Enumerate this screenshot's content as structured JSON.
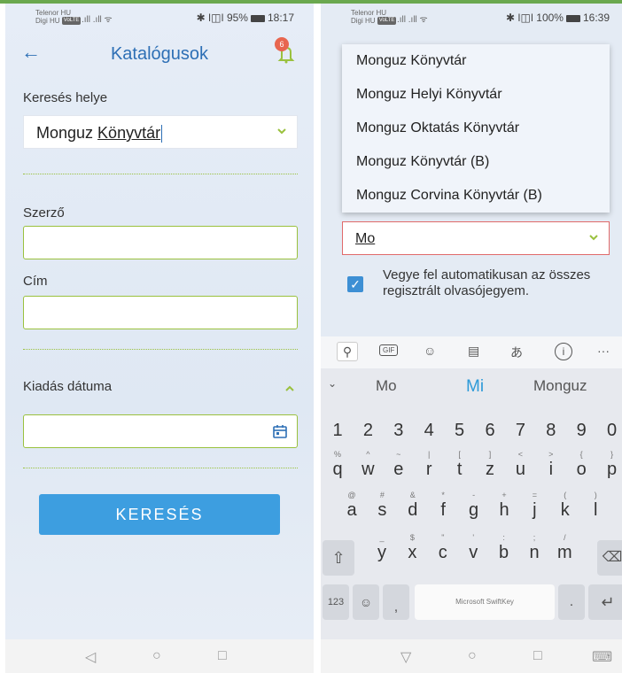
{
  "left": {
    "status": {
      "carrier1": "Telenor HU",
      "carrier2": "Digi HU",
      "volte": "VoLTE",
      "signal": ".ıll .ıll ᯤ",
      "right": "✱ ǀ◫ǀ 95%",
      "time": "18:17"
    },
    "header": {
      "back": "←",
      "title": "Katalógusok",
      "badge": "6"
    },
    "search_place_label": "Keresés helye",
    "search_place_value_a": "Monguz ",
    "search_place_value_b": "Könyvtár",
    "author_label": "Szerző",
    "title_label": "Cím",
    "date_section": "Kiadás dátuma",
    "search_button": "KERESÉS",
    "nav": {
      "back": "◁",
      "home": "○",
      "recent": "□"
    }
  },
  "right": {
    "status": {
      "carrier1": "Telenor HU",
      "carrier2": "Digi HU",
      "volte": "VoLTE",
      "signal": ".ıll .ıll ᯤ",
      "right": "✱ ǀ◫ǀ 100%",
      "time": "16:39"
    },
    "dropdown": [
      "Monguz Könyvtár",
      "Monguz Helyi Könyvtár",
      "Monguz Oktatás Könyvtár",
      "Monguz Könyvtár (B)",
      "Monguz Corvina Könyvtár (B)"
    ],
    "input_value": "Mo",
    "checkbox_text": "Vegye fel automatikusan az összes regisztrált olvasójegyem.",
    "toolbar": {
      "gif": "GIF",
      "more": "···"
    },
    "suggestions": [
      "Mo",
      "Mi",
      "Monguz"
    ],
    "numbers": [
      "1",
      "2",
      "3",
      "4",
      "5",
      "6",
      "7",
      "8",
      "9",
      "0"
    ],
    "row_q": [
      {
        "k": "q",
        "s": "%"
      },
      {
        "k": "w",
        "s": "^"
      },
      {
        "k": "e",
        "s": "~"
      },
      {
        "k": "r",
        "s": "|"
      },
      {
        "k": "t",
        "s": "["
      },
      {
        "k": "z",
        "s": "]"
      },
      {
        "k": "u",
        "s": "<"
      },
      {
        "k": "i",
        "s": ">"
      },
      {
        "k": "o",
        "s": "{"
      },
      {
        "k": "p",
        "s": "}"
      }
    ],
    "row_a": [
      {
        "k": "a",
        "s": "@"
      },
      {
        "k": "s",
        "s": "#"
      },
      {
        "k": "d",
        "s": "&"
      },
      {
        "k": "f",
        "s": "*"
      },
      {
        "k": "g",
        "s": "-"
      },
      {
        "k": "h",
        "s": "+"
      },
      {
        "k": "j",
        "s": "="
      },
      {
        "k": "k",
        "s": "("
      },
      {
        "k": "l",
        "s": ")"
      }
    ],
    "row_y": [
      {
        "k": "y",
        "s": "_"
      },
      {
        "k": "x",
        "s": "$"
      },
      {
        "k": "c",
        "s": "\""
      },
      {
        "k": "v",
        "s": "'"
      },
      {
        "k": "b",
        "s": ":"
      },
      {
        "k": "n",
        "s": ";"
      },
      {
        "k": "m",
        "s": "/"
      }
    ],
    "key_123": "123",
    "space_label": "Microsoft SwiftKey",
    "comma": ",",
    "period": ".",
    "period_sup": ",!?",
    "nav": {
      "back": "▽",
      "home": "○",
      "recent": "□",
      "kbd": "⌨"
    }
  },
  "colors": {
    "accent": "#2d6fb5",
    "green": "#9ac13e",
    "button": "#3d9ee0",
    "badge": "#e8664f"
  }
}
